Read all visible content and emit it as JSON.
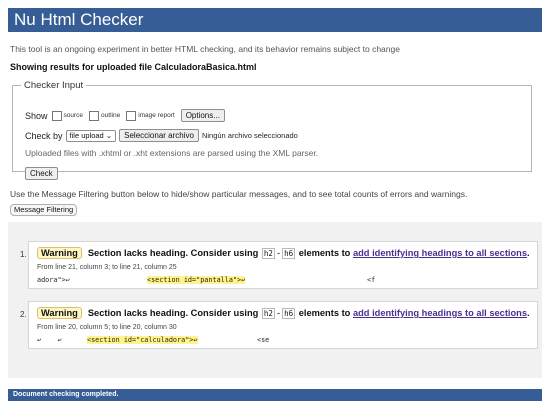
{
  "header": {
    "title": "Nu Html Checker"
  },
  "intro": "This tool is an ongoing experiment in better HTML checking, and its behavior remains subject to change",
  "results_heading": "Showing results for uploaded file CalculadoraBasica.html",
  "checker_input": {
    "legend": "Checker Input",
    "show_label": "Show",
    "show_options": [
      "source",
      "outline",
      "image report"
    ],
    "options_button": "Options...",
    "check_by_label": "Check by",
    "check_by_value": "file upload",
    "file_button": "Seleccionar archivo",
    "file_status": "Ningún archivo seleccionado",
    "upload_note": "Uploaded files with .xhtml or .xht extensions are parsed using the XML parser.",
    "check_button": "Check"
  },
  "filter": {
    "text": "Use the Message Filtering button below to hide/show particular messages, and to see total counts of errors and warnings.",
    "button": "Message Filtering"
  },
  "messages": [
    {
      "number": "1.",
      "type": "Warning",
      "text": "Section lacks heading. Consider using",
      "tag_a": "h2",
      "dash": "-",
      "tag_b": "h6",
      "middle": "elements to",
      "link": "add identifying headings to all sections",
      "end": ".",
      "location": "From line 21, column 3; to line 21, column 25",
      "code_before": "adora\">↩",
      "code_highlight": "<section id=\"pantalla\">↩",
      "code_after": "<f"
    },
    {
      "number": "2.",
      "type": "Warning",
      "text": "Section lacks heading. Consider using",
      "tag_a": "h2",
      "dash": "-",
      "tag_b": "h6",
      "middle": "elements to",
      "link": "add identifying headings to all sections",
      "end": ".",
      "location": "From line 20, column 5; to line 20, column 30",
      "code_before": "↩    ↩",
      "code_highlight": "<section id=\"calculadora\">↩",
      "code_after": "<se"
    }
  ],
  "footer": "Document checking completed."
}
